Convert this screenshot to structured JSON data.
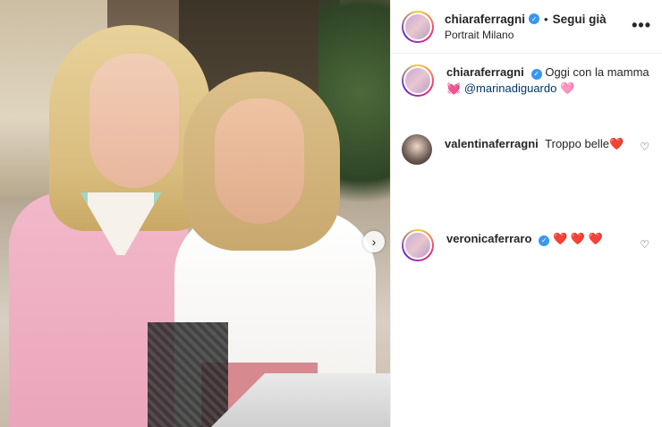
{
  "post": {
    "image_alt": "Chiara Ferragni with her mother at a restaurant"
  },
  "header": {
    "username": "chiaraferragni",
    "verified_icon": "verified-badge-icon",
    "separator": "•",
    "follow_status": "Segui già",
    "location": "Portrait Milano",
    "more_icon": "•••"
  },
  "caption": {
    "username": "chiaraferragni",
    "text": "Oggi con la mamma",
    "emoji": "💓",
    "mention": "@marinadiguardo",
    "trailing": "🩷"
  },
  "comments": [
    {
      "username": "valentinaferragni",
      "text": "Troppo belle",
      "emoji": "❤️",
      "like_icon": "♡"
    },
    {
      "username": "veronicaferraro",
      "verified": true,
      "emoji": "❤️ ❤️ ❤️",
      "like_icon": "♡"
    }
  ],
  "carousel": {
    "next_icon": "›"
  },
  "colors": {
    "verified": "#3897f0",
    "mention": "#00376b",
    "heart": "#ed1c24"
  }
}
